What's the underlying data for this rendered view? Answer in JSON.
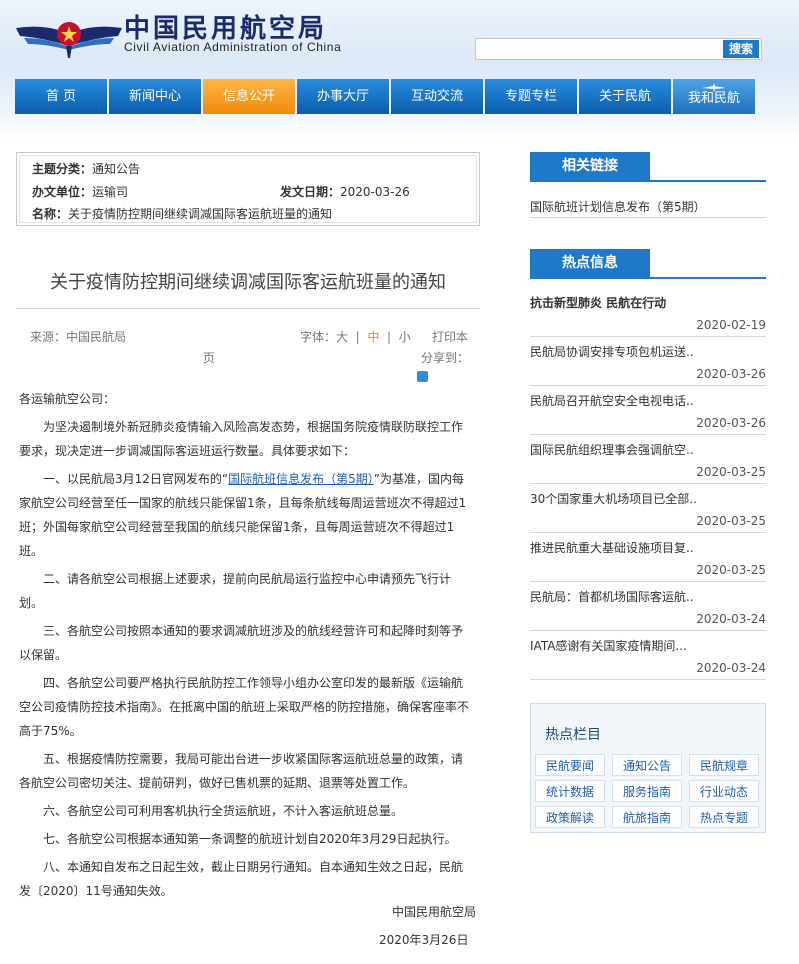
{
  "header": {
    "title_cn": "中国民用航空局",
    "title_en": "Civil Aviation Administration of China",
    "search_placeholder": "",
    "search_button": "搜索"
  },
  "nav": [
    {
      "label": "首 页"
    },
    {
      "label": "新闻中心"
    },
    {
      "label": "信息公开",
      "active": true
    },
    {
      "label": "办事大厅"
    },
    {
      "label": "互动交流"
    },
    {
      "label": "专题专栏"
    },
    {
      "label": "关于民航"
    },
    {
      "label": "我和民航"
    }
  ],
  "meta": {
    "category_label": "主题分类：",
    "category_value": "通知公告",
    "office_label": "办文单位：",
    "office_value": "运输司",
    "date_label": "发文日期：",
    "date_value": "2020-03-26",
    "name_label": "名称：",
    "name_value": "关于疫情防控期间继续调减国际客运航班量的通知"
  },
  "article": {
    "title": "关于疫情防控期间继续调减国际客运航班量的通知",
    "source": "来源：中国民航局",
    "font_label": "字体：",
    "font_large": "大",
    "font_sep1": "|",
    "font_medium": "中",
    "font_sep2": "|",
    "font_small": "小",
    "print_part1": "打印本",
    "print_part2": "页",
    "share_label": "分享到：",
    "salutation": "各运输航空公司：",
    "intro": "为坚决遏制境外新冠肺炎疫情输入风险高发态势，根据国务院疫情联防联控工作要求，现决定进一步调减国际客运班运行数量。具体要求如下：",
    "p1_before": "一、以民航局3月12日官网发布的“",
    "p1_link": "国际航班信息发布（第5期）",
    "p1_after": "”为基准，国内每家航空公司经营至任一国家的航线只能保留1条，且每条航线每周运营班次不得超过1班；外国每家航空公司经营至我国的航线只能保留1条，且每周运营班次不得超过1班。",
    "p2": "二、请各航空公司根据上述要求，提前向民航局运行监控中心申请预先飞行计划。",
    "p3": "三、各航空公司按照本通知的要求调减航班涉及的航线经营许可和起降时刻等予以保留。",
    "p4": "四、各航空公司要严格执行民航防控工作领导小组办公室印发的最新版《运输航空公司疫情防控技术指南》。在抵离中国的航班上采取严格的防控措施，确保客座率不高于75%。",
    "p5": "五、根据疫情防控需要，我局可能出台进一步收紧国际客运航班总量的政策，请各航空公司密切关注、提前研判，做好已售机票的延期、退票等处置工作。",
    "p6": "六、各航空公司可利用客机执行全货运航班，不计入客运航班总量。",
    "p7": "七、各航空公司根据本通知第一条调整的航班计划自2020年3月29日起执行。",
    "p8": "八、本通知自发布之日起生效，截止日期另行通知。自本通知生效之日起，民航发〔2020〕11号通知失效。",
    "signature_org": "中国民用航空局",
    "signature_date": "2020年3月26日"
  },
  "sidebar": {
    "related_title": "相关链接",
    "related_links": [
      "国际航班计划信息发布（第5期）"
    ],
    "hot_title": "热点信息",
    "hot_top": "抗击新型肺炎 民航在行动",
    "hot_items": [
      {
        "title": "",
        "date": "2020-02-19"
      },
      {
        "title": "民航局协调安排专项包机运送..",
        "date": "2020-03-26"
      },
      {
        "title": "民航局召开航空安全电视电话..",
        "date": "2020-03-26"
      },
      {
        "title": "国际民航组织理事会强调航空..",
        "date": "2020-03-25"
      },
      {
        "title": "30个国家重大机场项目已全部..",
        "date": "2020-03-25"
      },
      {
        "title": "推进民航重大基础设施项目复..",
        "date": "2020-03-25"
      },
      {
        "title": "民航局：首都机场国际客运航..",
        "date": "2020-03-24"
      },
      {
        "title": "IATA感谢有关国家疫情期间...",
        "date": "2020-03-24"
      }
    ],
    "columns_title": "热点栏目",
    "columns": [
      "民航要闻",
      "通知公告",
      "民航规章",
      "统计数据",
      "服务指南",
      "行业动态",
      "政策解读",
      "航旅指南",
      "热点专题"
    ]
  },
  "colors": {
    "nav_blue": "#1f78c8",
    "nav_active_orange": "#f08a0c",
    "title_navy": "#1a2a6c"
  }
}
